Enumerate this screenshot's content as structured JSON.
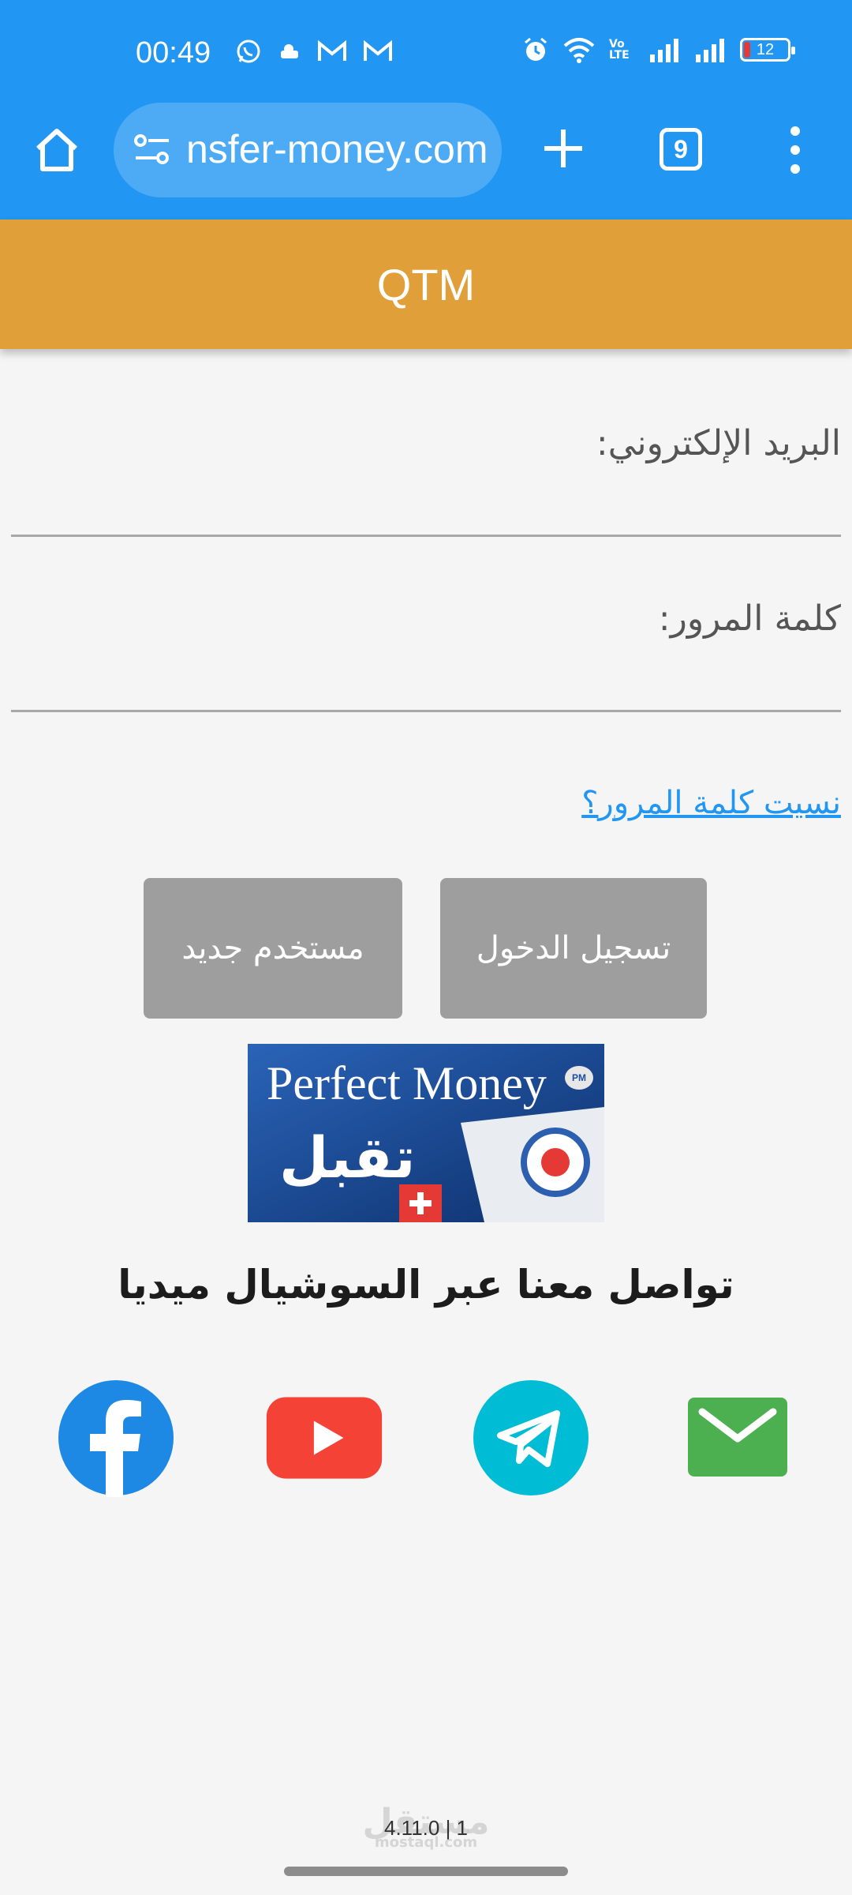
{
  "status_bar": {
    "time": "00:49",
    "battery": "12",
    "network_label": "Vo LTE"
  },
  "browser": {
    "url": "​nsfer-money.com",
    "tab_count": "9"
  },
  "app": {
    "title": "QTM"
  },
  "form": {
    "email_label": "البريد الإلكتروني:",
    "password_label": "كلمة المرور:",
    "forgot_link": "نسيت كلمة المرور؟"
  },
  "buttons": {
    "login": "تسجيل الدخول",
    "register": "مستخدم جديد"
  },
  "banner": {
    "title": "Perfect Money",
    "badge": "PM",
    "arabic": "تقبل"
  },
  "social": {
    "heading": "تواصل معنا عبر السوشيال ميديا",
    "icons": [
      "facebook-icon",
      "youtube-icon",
      "telegram-icon",
      "email-icon"
    ]
  },
  "footer": {
    "version": "4.11.0 | 1",
    "watermark": "مستقل",
    "watermark_sub": "mostaql.com"
  },
  "colors": {
    "chrome": "#2196f3",
    "header": "#e09f38",
    "button": "#9e9e9e",
    "link": "#2196f3",
    "facebook": "#1e88e5",
    "youtube": "#f44336",
    "telegram": "#00bcd4",
    "email": "#4caf50"
  }
}
